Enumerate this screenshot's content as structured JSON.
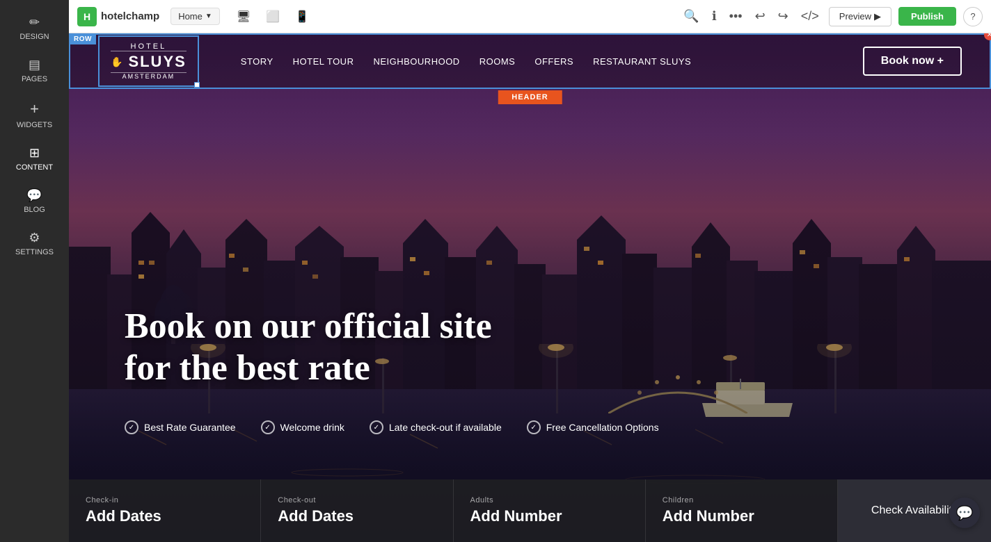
{
  "brand": {
    "logo_letter": "H",
    "name": "hotelchamp"
  },
  "topbar": {
    "page_selector_label": "Home",
    "preview_label": "Preview",
    "preview_icon": "▶",
    "publish_label": "Publish",
    "more_icon": "•••",
    "undo_icon": "↩",
    "redo_icon": "↪",
    "code_icon": "</>",
    "search_icon": "🔍",
    "info_icon": "ℹ",
    "help_icon": "?"
  },
  "sidebar": {
    "items": [
      {
        "id": "design",
        "label": "DESIGN",
        "icon": "✏"
      },
      {
        "id": "pages",
        "label": "PAGES",
        "icon": "📄"
      },
      {
        "id": "widgets",
        "label": "WIDGETS",
        "icon": "+"
      },
      {
        "id": "content",
        "label": "CONTENT",
        "icon": "⊞",
        "active": true
      },
      {
        "id": "blog",
        "label": "BLOG",
        "icon": "💬"
      },
      {
        "id": "settings",
        "label": "SETTINGS",
        "icon": "⚙"
      }
    ]
  },
  "canvas": {
    "row_label": "ROW",
    "header_label": "HEADER"
  },
  "navbar": {
    "logo_line1": "HOTEL",
    "logo_main": "SLUYS",
    "logo_line3": "AMSTERDAM",
    "links": [
      "STORY",
      "HOTEL TOUR",
      "NEIGHBOURHOOD",
      "ROOMS",
      "OFFERS",
      "RESTAURANT SLUYS"
    ],
    "book_now": "Book now +"
  },
  "hero": {
    "headline_line1": "Book on our official site",
    "headline_line2": "for the  best rate",
    "features": [
      "Best Rate Guarantee",
      "Welcome drink",
      "Late check-out if available",
      "Free Cancellation Options"
    ]
  },
  "booking": {
    "checkin_label": "Check-in",
    "checkin_value": "Add Dates",
    "checkout_label": "Check-out",
    "checkout_value": "Add Dates",
    "adults_label": "Adults",
    "adults_value": "Add Number",
    "children_label": "Children",
    "children_value": "Add Number",
    "cta_label": "Check Availability"
  },
  "colors": {
    "green": "#3ab54a",
    "orange": "#e8541e",
    "blue": "#4a90d9"
  }
}
